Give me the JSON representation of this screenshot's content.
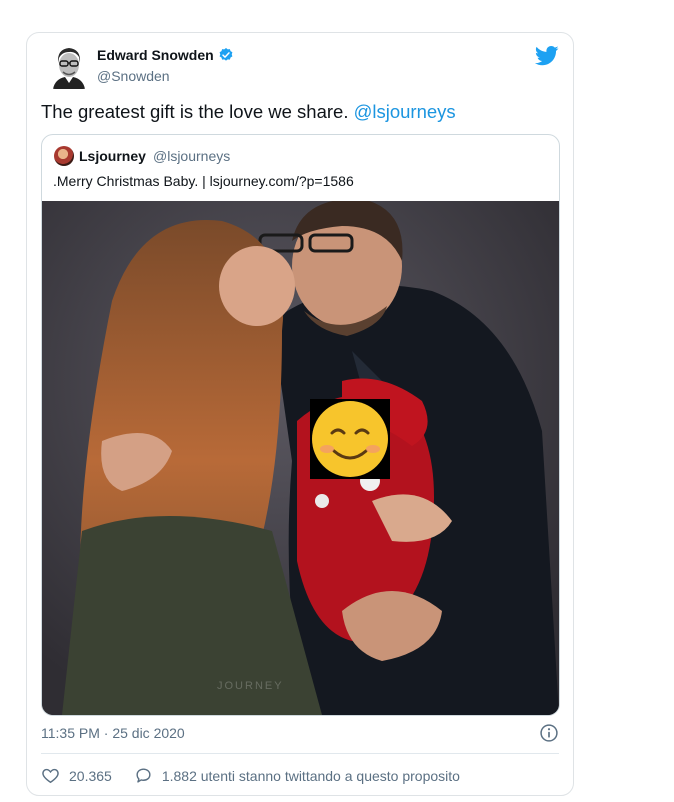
{
  "tweet": {
    "author_name": "Edward Snowden",
    "author_handle": "@Snowden",
    "text_before": "The greatest gift is the love we share. ",
    "mention": "@lsjourneys",
    "timestamp": "11:35 PM · 25 dic 2020",
    "likes": "20.365",
    "conversation": "1.882 utenti stanno twittando a questo proposito"
  },
  "quoted": {
    "author_name": "Lsjourney",
    "author_handle": "@lsjourneys",
    "text": ".Merry Christmas Baby. | lsjourney.com/?p=1586",
    "watermark": "JOURNEY"
  },
  "icons": {
    "verified": "verified-badge-icon",
    "logo": "twitter-bird-icon",
    "info": "info-icon",
    "like": "heart-icon",
    "reply": "speech-bubble-icon"
  },
  "colors": {
    "accent": "#1da1f2",
    "mention": "#1b95e0",
    "muted": "#5b7083"
  }
}
